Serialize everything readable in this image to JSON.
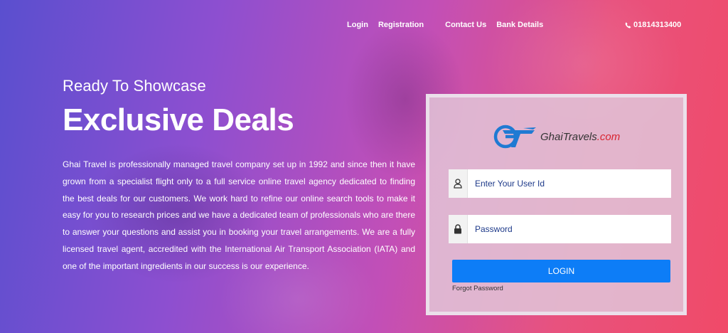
{
  "nav": {
    "login": "Login",
    "registration": "Registration",
    "contact": "Contact Us",
    "bank": "Bank Details"
  },
  "phone": {
    "icon": "phone-icon",
    "number": "01814313400"
  },
  "hero": {
    "subtitle": "Ready To Showcase",
    "title": "Exclusive Deals",
    "description": "Ghai Travel is professionally managed travel company set up in 1992 and since then it have grown from a specialist flight only to a full service online travel agency dedicated to finding the best deals for our customers. We work hard to refine our online search tools to make it easy for you to research prices and we have a dedicated team of professionals who are there to answer your questions and assist you in booking your travel arrangements. We are a fully licensed travel agent, accredited with the International Air Transport Association (IATA) and one of the important ingredients in our success is our experience."
  },
  "login": {
    "logo_name": "Ghai",
    "logo_suffix": "Travels",
    "logo_domain": ".com",
    "user_placeholder": "Enter Your User Id",
    "password_placeholder": "Password",
    "button": "LOGIN",
    "forgot": "Forgot Password"
  },
  "colors": {
    "button": "#0d7df7",
    "brand_blue": "#1f7ad3",
    "brand_red": "#d9232f",
    "gradient_start": "#5a4fcf",
    "gradient_end": "#f04a68"
  }
}
